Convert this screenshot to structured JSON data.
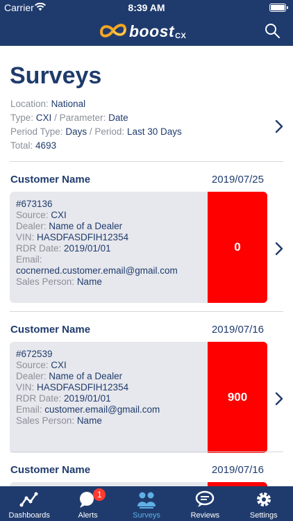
{
  "status_bar": {
    "carrier": "Carrier",
    "time": "8:39 AM"
  },
  "header": {
    "logo_text": "boost",
    "logo_sub": "CX",
    "search_icon": "search-icon"
  },
  "page": {
    "title": "Surveys",
    "filters": {
      "location_label": "Location:",
      "location": "National",
      "type_label": "Type:",
      "type": "CXI",
      "parameter_label": "Parameter:",
      "parameter": "Date",
      "period_type_label": "Period Type:",
      "period_type": "Days",
      "period_label": "Period:",
      "period": "Last 30 Days",
      "total_label": "Total:",
      "total": "4693"
    },
    "surveys": [
      {
        "customer": "Customer Name",
        "date": "2019/07/25",
        "id": "#673136",
        "source_label": "Source:",
        "source": "CXI",
        "dealer_label": "Dealer:",
        "dealer": "Name of a Dealer",
        "vin_label": "VIN:",
        "vin": "HASDFASDFIH12354",
        "rdr_label": "RDR Date:",
        "rdr": "2019/01/01",
        "email_label": "Email:",
        "email": "cocnerned.customer.email@gmail.com",
        "sales_label": "Sales Person:",
        "sales": "Name",
        "score": "0",
        "score_color": "#ff0000"
      },
      {
        "customer": "Customer Name",
        "date": "2019/07/16",
        "id": "#672539",
        "source_label": "Source:",
        "source": "CXI",
        "dealer_label": "Dealer:",
        "dealer": "Name of a Dealer",
        "vin_label": "VIN:",
        "vin": "HASDFASDFIH12354",
        "rdr_label": "RDR Date:",
        "rdr": "2019/01/01",
        "email_label": "Email:",
        "email": "customer.email@gmail.com",
        "sales_label": "Sales Person:",
        "sales": "Name",
        "score": "900",
        "score_color": "#ff0000"
      },
      {
        "customer": "Customer Name",
        "date": "2019/07/16"
      }
    ]
  },
  "tabbar": {
    "tabs": [
      {
        "label": "Dashboards",
        "icon": "dashboards-icon"
      },
      {
        "label": "Alerts",
        "icon": "alerts-icon",
        "badge": "1"
      },
      {
        "label": "Surveys",
        "icon": "surveys-icon",
        "active": true
      },
      {
        "label": "Reviews",
        "icon": "reviews-icon"
      },
      {
        "label": "Settings",
        "icon": "settings-icon"
      }
    ]
  },
  "colors": {
    "navy": "#1f3b6d",
    "accent_blue": "#5fb0e6",
    "score_red": "#ff0000",
    "card_bg": "#e7e8ed",
    "label_gray": "#8a8f98",
    "badge_red": "#ff3b30"
  }
}
